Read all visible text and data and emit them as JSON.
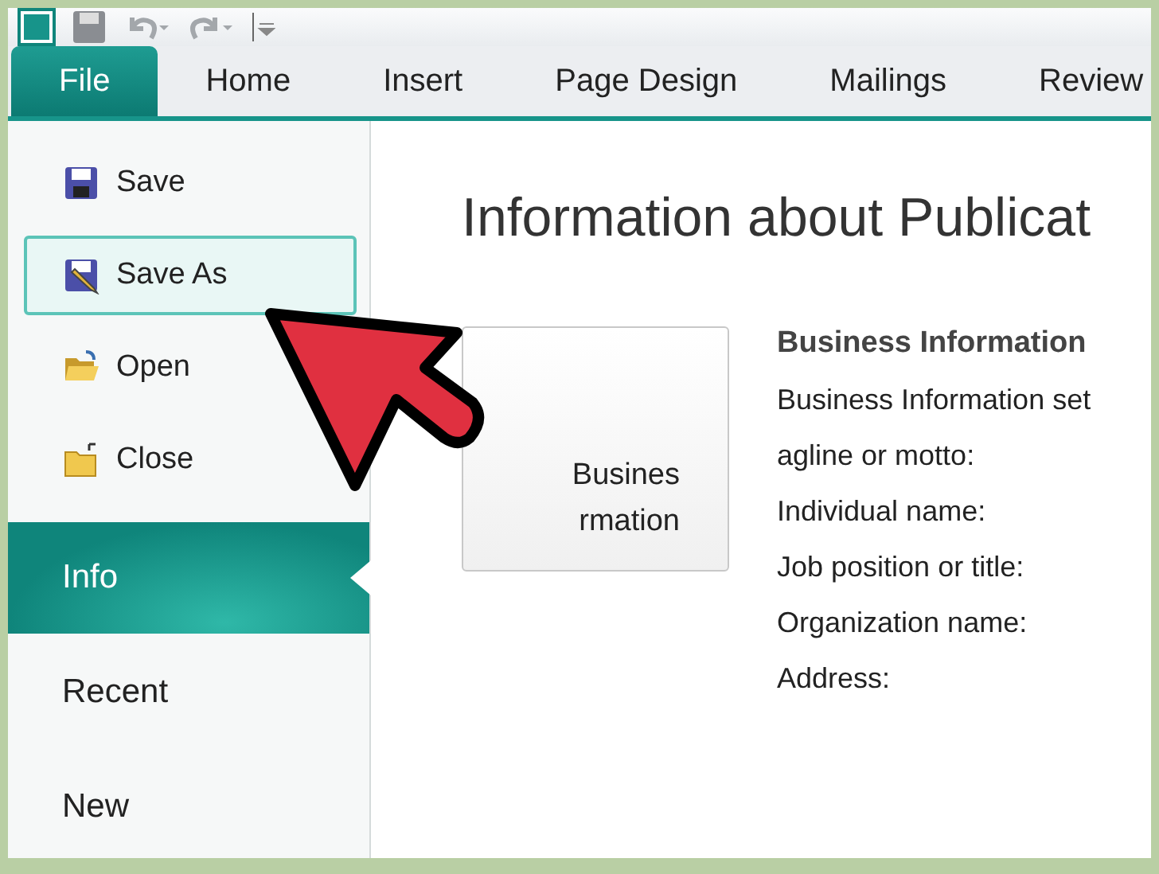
{
  "ribbon_tabs": [
    {
      "label": "File",
      "selected": true
    },
    {
      "label": "Home",
      "selected": false
    },
    {
      "label": "Insert",
      "selected": false
    },
    {
      "label": "Page Design",
      "selected": false
    },
    {
      "label": "Mailings",
      "selected": false
    },
    {
      "label": "Review",
      "selected": false
    }
  ],
  "menu": {
    "commands": [
      {
        "label": "Save",
        "kind": "save",
        "selected": false
      },
      {
        "label": "Save As",
        "kind": "save-as",
        "selected": true
      },
      {
        "label": "Open",
        "kind": "open",
        "selected": false
      },
      {
        "label": "Close",
        "kind": "close",
        "selected": false
      }
    ],
    "sections": [
      {
        "label": "Info",
        "selected": true
      },
      {
        "label": "Recent",
        "selected": false
      },
      {
        "label": "New",
        "selected": false
      }
    ]
  },
  "content": {
    "title": "Information about Publicat",
    "button_lines": [
      "Busines",
      "rmation"
    ],
    "business_heading": "Business Information",
    "fields": [
      "Business Information set",
      "agline or motto:",
      "Individual name:",
      "Job position or title:",
      "Organization name:",
      "Address:"
    ]
  }
}
